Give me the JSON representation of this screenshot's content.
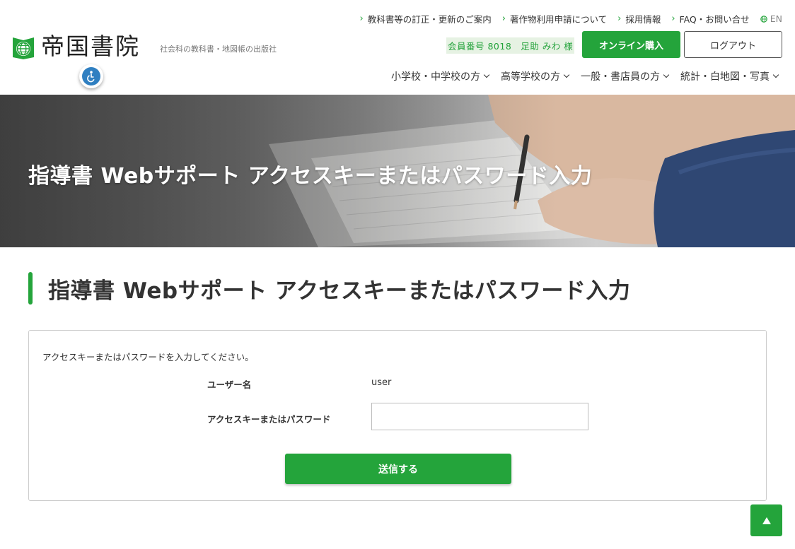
{
  "header": {
    "logo_text": "帝国書院",
    "tagline": "社会科の教科書・地図帳の出版社",
    "util_links": [
      {
        "label": "教科書等の訂正・更新のご案内"
      },
      {
        "label": "著作物利用申請について"
      },
      {
        "label": "採用情報"
      },
      {
        "label": "FAQ・お問い合せ"
      }
    ],
    "lang_label": "EN",
    "member_info": "会員番号 8018　足助 みわ 様",
    "buy_label": "オンライン購入",
    "logout_label": "ログアウト",
    "nav": [
      {
        "label": "小学校・中学校の方"
      },
      {
        "label": "高等学校の方"
      },
      {
        "label": "一般・書店員の方"
      },
      {
        "label": "統計・白地図・写真"
      }
    ],
    "accent_color": "#24a43b"
  },
  "hero": {
    "title": "指導書 Webサポート アクセスキーまたはパスワード入力"
  },
  "page": {
    "heading": "指導書 Webサポート アクセスキーまたはパスワード入力"
  },
  "form": {
    "instruction": "アクセスキーまたはパスワードを入力してください。",
    "username_label": "ユーザー名",
    "username_value": "user",
    "password_label": "アクセスキーまたはパスワード",
    "password_value": "",
    "submit_label": "送信する"
  },
  "pagetop": {
    "icon": "arrow-up-icon"
  }
}
